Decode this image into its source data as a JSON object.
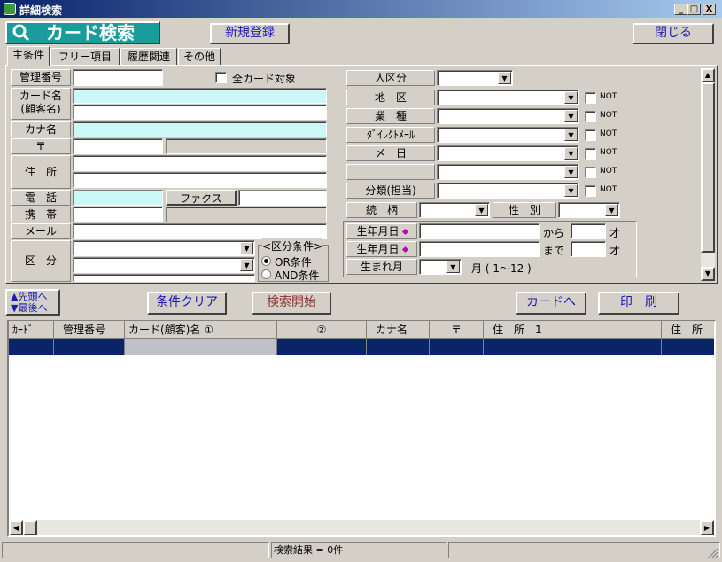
{
  "window": {
    "title": "詳細検索",
    "min": "_",
    "max": "□",
    "close": "X"
  },
  "header": {
    "title": "カード検索",
    "new_btn": "新規登録",
    "close_btn": "閉じる"
  },
  "tabs": [
    "主条件",
    "フリー項目",
    "履歴関連",
    "その他"
  ],
  "left": {
    "mgmt_no": "管理番号",
    "all_cards": "全カード対象",
    "card_name": "カード名",
    "card_name2": "(顧客名)",
    "kana": "カナ名",
    "zip": "〒",
    "address": "住　所",
    "phone": "電　話",
    "fax": "ファクス",
    "mobile": "携　帯",
    "mail": "メール",
    "kubun": "区　分",
    "kubun_cond": "<区分条件>",
    "or": "OR条件",
    "and": "AND条件"
  },
  "right": {
    "jin": "人区分",
    "chiku": "地　区",
    "gyoshu": "業　種",
    "dm": "ﾀﾞｲﾚｸﾄﾒｰﾙ",
    "shime": "〆　日",
    "bunrui": "分類(担当)",
    "not": "NOT",
    "zokugara": "続　柄",
    "seibetsu": "性　別",
    "birth1": "生年月日",
    "birth2": "生年月日",
    "birth_month": "生まれ月",
    "kara": "から",
    "made": "まで",
    "sai": "才",
    "tsuki": "月 ( 1～12 )"
  },
  "toolbar": {
    "first": "▲先頭へ",
    "last": "▼最後へ",
    "clear": "条件クリア",
    "search": "検索開始",
    "to_card": "カードへ",
    "print": "印　刷"
  },
  "table": {
    "headers": [
      "ｶｰﾄﾞ",
      "管理番号",
      "カード(顧客)名 ①",
      "②",
      "カナ名",
      "〒",
      "住　所　1",
      "住　所"
    ]
  },
  "status": {
    "result": "検索結果 = 0件"
  },
  "colors": {
    "title_bg": "#0a246a",
    "header_title_bg": "#1a9c9c",
    "cyan_field": "#ccf8f8",
    "selected_row": "#0a246a"
  }
}
